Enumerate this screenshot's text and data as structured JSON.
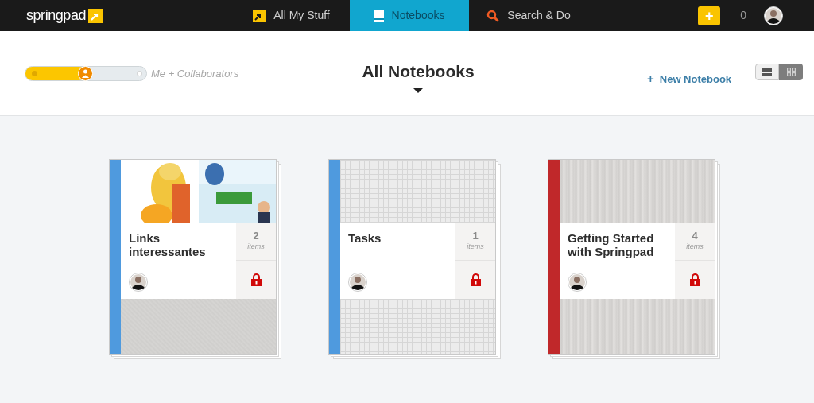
{
  "logo": "springpad",
  "nav": [
    {
      "label": "All My Stuff",
      "kind": "stuff",
      "selected": false
    },
    {
      "label": "Notebooks",
      "kind": "notebook",
      "selected": true
    },
    {
      "label": "Search & Do",
      "kind": "search",
      "selected": false
    }
  ],
  "add_button": "+",
  "notification_count": "0",
  "slider": {
    "level": 0.5,
    "label": "Me + Collaborators"
  },
  "heading": "All Notebooks",
  "new_notebook": {
    "icon": "+",
    "label": "New Notebook"
  },
  "view_toggle": [
    {
      "kind": "list",
      "selected": false
    },
    {
      "kind": "grid",
      "selected": true
    }
  ],
  "notebooks": [
    {
      "title": "Links interessantes",
      "count": "2",
      "unit": "items",
      "color": "#4f9ade",
      "kind": "picture"
    },
    {
      "title": "Tasks",
      "count": "1",
      "unit": "items",
      "color": "#4f9ade",
      "kind": "grid"
    },
    {
      "title": "Getting Started with Springpad",
      "count": "4",
      "unit": "items",
      "color": "#c0282a",
      "kind": "wood"
    }
  ]
}
